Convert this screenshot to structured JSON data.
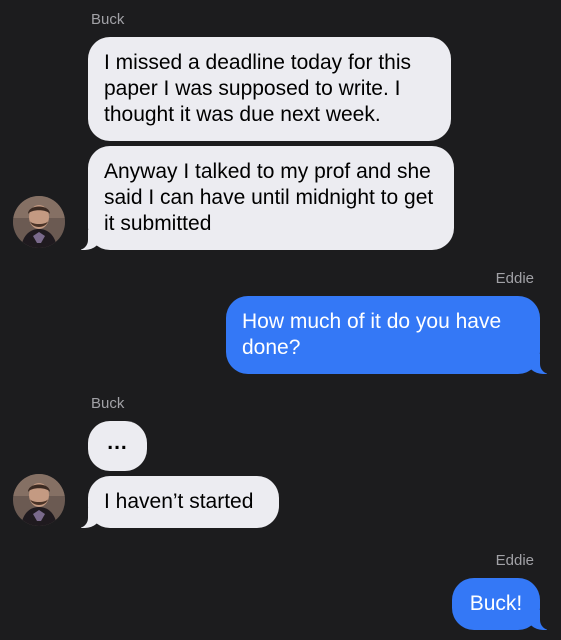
{
  "conversation": {
    "groups": [
      {
        "sender": "Buck",
        "messages": [
          "I missed a deadline today for this paper I was supposed to write. I thought it was due next week.",
          "Anyway I talked to my prof and she said I can have until midnight to get it submitted"
        ]
      },
      {
        "sender": "Eddie",
        "messages": [
          "How much of it do you have done?"
        ]
      },
      {
        "sender": "Buck",
        "messages": [
          "...",
          "I haven’t started"
        ]
      },
      {
        "sender": "Eddie",
        "messages": [
          "Buck!"
        ]
      }
    ]
  },
  "colors": {
    "background": "#1c1c1e",
    "incoming_bubble": "#ececf1",
    "outgoing_bubble": "#3478f6",
    "sender_label": "#a1a1a6"
  },
  "avatar_icon": "person-photo-icon"
}
